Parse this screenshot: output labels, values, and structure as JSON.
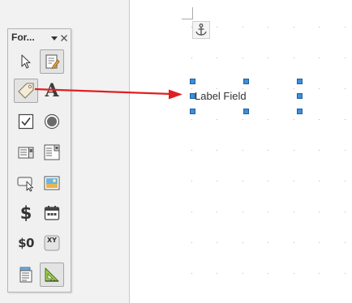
{
  "toolbar": {
    "title": "For...",
    "menu_icon": "chevron-down-icon",
    "close_icon": "close-icon",
    "tools": [
      {
        "name": "select-tool",
        "icon": "cursor-arrow-icon"
      },
      {
        "name": "design-mode-tool",
        "icon": "design-mode-icon",
        "active": true
      },
      {
        "name": "label-tool",
        "icon": "tag-icon",
        "active": true
      },
      {
        "name": "text-box-tool",
        "icon": "letter-a-icon",
        "glyph": "A"
      },
      {
        "name": "check-box-tool",
        "icon": "checkbox-icon"
      },
      {
        "name": "option-button-tool",
        "icon": "radio-icon"
      },
      {
        "name": "list-box-tool",
        "icon": "list-box-icon"
      },
      {
        "name": "combo-box-tool",
        "icon": "combo-box-icon"
      },
      {
        "name": "push-button-tool",
        "icon": "push-button-icon"
      },
      {
        "name": "image-button-tool",
        "icon": "image-button-icon"
      },
      {
        "name": "currency-field-tool",
        "icon": "dollar-icon",
        "glyph": "$"
      },
      {
        "name": "date-field-tool",
        "icon": "calendar-icon"
      },
      {
        "name": "formatted-field-tool",
        "icon": "formatted-field-icon",
        "glyph": "$0"
      },
      {
        "name": "chart-xy-tool",
        "icon": "xy-icon",
        "glyph": "XY"
      },
      {
        "name": "form-navigator-tool",
        "icon": "form-navigator-icon"
      },
      {
        "name": "wizard-tool",
        "icon": "wizard-icon",
        "active": true
      }
    ]
  },
  "canvas": {
    "label_field": {
      "text": "Label Field"
    },
    "anchor_icon": "anchor-icon"
  },
  "colors": {
    "selection_handle": "#3b8fdb",
    "arrow": "#e02020",
    "page": "#ffffff",
    "workspace": "#f2f2f2"
  }
}
